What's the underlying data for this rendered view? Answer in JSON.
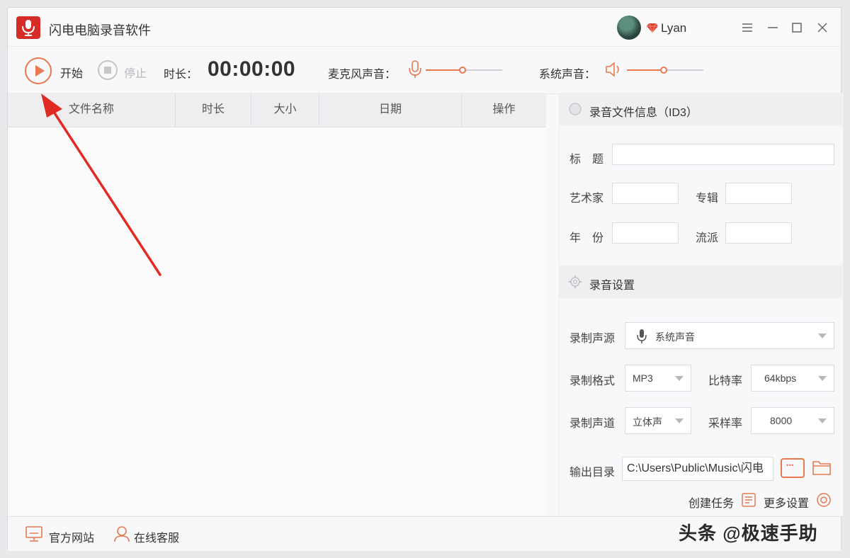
{
  "app": {
    "title": "闪电电脑录音软件",
    "accent": "#e8784f",
    "logo_color": "#d62b27"
  },
  "user": {
    "name": "Lyan"
  },
  "toolbar": {
    "start_label": "开始",
    "stop_label": "停止",
    "duration_label": "时长：",
    "duration_value": "00:00:00",
    "mic_label": "麦克风声音：",
    "mic_level": 0.48,
    "system_label": "系统声音：",
    "system_level": 0.48
  },
  "table": {
    "columns": [
      "文件名称",
      "时长",
      "大小",
      "日期",
      "操作"
    ],
    "rows": []
  },
  "id3": {
    "section_title": "录音文件信息（ID3）",
    "title_label": "标　题",
    "title_value": "",
    "artist_label": "艺术家",
    "artist_value": "",
    "album_label": "专辑",
    "album_value": "",
    "year_label": "年　份",
    "year_value": "",
    "genre_label": "流派",
    "genre_value": ""
  },
  "settings": {
    "section_title": "录音设置",
    "source_label": "录制声源",
    "source_value": "系统声音",
    "format_label": "录制格式",
    "format_value": "MP3",
    "bitrate_label": "比特率",
    "bitrate_value": "64kbps",
    "channel_label": "录制声道",
    "channel_value": "立体声",
    "samplerate_label": "采样率",
    "samplerate_value": "8000",
    "output_label": "输出目录",
    "output_value": "C:\\Users\\Public\\Music\\闪电",
    "create_task_label": "创建任务",
    "more_settings_label": "更多设置"
  },
  "footer": {
    "website_label": "官方网站",
    "support_label": "在线客服"
  },
  "watermark": "头条 @极速手助"
}
